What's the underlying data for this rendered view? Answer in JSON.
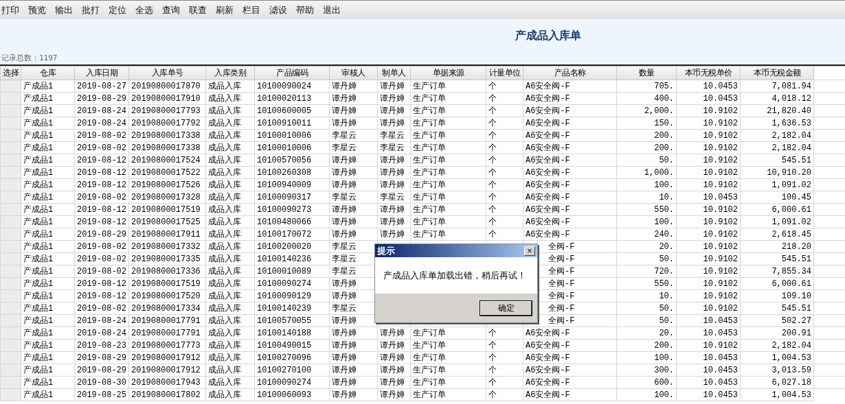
{
  "menu": [
    "打印",
    "预览",
    "输出",
    "批打",
    "定位",
    "全选",
    "查询",
    "联查",
    "刷新",
    "栏目",
    "滤设",
    "帮助",
    "退出"
  ],
  "title": "产成品入库单",
  "record_count": "记录总数：1197",
  "table": {
    "columns": [
      {
        "label": "选择",
        "kind": "selector"
      },
      {
        "label": "仓库",
        "kind": "text"
      },
      {
        "label": "入库日期",
        "kind": "text"
      },
      {
        "label": "入库单号",
        "kind": "text"
      },
      {
        "label": "入库类别",
        "kind": "text"
      },
      {
        "label": "产品编码",
        "kind": "text"
      },
      {
        "label": "审核人",
        "kind": "text"
      },
      {
        "label": "制单人",
        "kind": "text"
      },
      {
        "label": "单据来源",
        "kind": "text"
      },
      {
        "label": "计量单位",
        "kind": "text"
      },
      {
        "label": "产品名称",
        "kind": "text"
      },
      {
        "label": "数量",
        "kind": "number"
      },
      {
        "label": "本币无税单价",
        "kind": "number"
      },
      {
        "label": "本币无税金额",
        "kind": "number"
      }
    ],
    "rows": [
      {
        "covered": false,
        "cells": [
          "",
          "产成品1",
          "2019-08-27",
          "20190800017870",
          "成品入库",
          "10100090024",
          "谭丹婵",
          "谭丹婵",
          "生产订单",
          "个",
          "A6安全阀-F",
          "705.",
          "10.0453",
          "7,081.94"
        ]
      },
      {
        "covered": false,
        "cells": [
          "",
          "产成品1",
          "2019-08-29",
          "20190800017910",
          "成品入库",
          "10100020113",
          "谭丹婵",
          "谭丹婵",
          "生产订单",
          "个",
          "A6安全阀-F",
          "400.",
          "10.0453",
          "4,018.12"
        ]
      },
      {
        "covered": false,
        "cells": [
          "",
          "产成品1",
          "2019-08-24",
          "20190800017793",
          "成品入库",
          "10100600005",
          "谭丹婵",
          "谭丹婵",
          "生产订单",
          "个",
          "A6安全阀-F",
          "2,000.",
          "10.9102",
          "21,820.40"
        ]
      },
      {
        "covered": false,
        "cells": [
          "",
          "产成品1",
          "2019-08-24",
          "20190800017792",
          "成品入库",
          "10100910011",
          "谭丹婵",
          "谭丹婵",
          "生产订单",
          "个",
          "A6安全阀-F",
          "150.",
          "10.9102",
          "1,636.53"
        ]
      },
      {
        "covered": false,
        "cells": [
          "",
          "产成品1",
          "2019-08-02",
          "20190800017338",
          "成品入库",
          "10100010006",
          "李星云",
          "李星云",
          "生产订单",
          "个",
          "A6安全阀-F",
          "200.",
          "10.9102",
          "2,182.04"
        ]
      },
      {
        "covered": false,
        "cells": [
          "",
          "产成品1",
          "2019-08-02",
          "20190800017338",
          "成品入库",
          "10100010006",
          "李星云",
          "李星云",
          "生产订单",
          "个",
          "A6安全阀-F",
          "200.",
          "10.9102",
          "2,182.04"
        ]
      },
      {
        "covered": false,
        "cells": [
          "",
          "产成品1",
          "2019-08-12",
          "20190800017524",
          "成品入库",
          "10100570056",
          "谭丹婵",
          "谭丹婵",
          "生产订单",
          "个",
          "A6安全阀-F",
          "50.",
          "10.9102",
          "545.51"
        ]
      },
      {
        "covered": false,
        "cells": [
          "",
          "产成品1",
          "2019-08-12",
          "20190800017522",
          "成品入库",
          "10100260308",
          "谭丹婵",
          "谭丹婵",
          "生产订单",
          "个",
          "A6安全阀-F",
          "1,000.",
          "10.9102",
          "10,910.20"
        ]
      },
      {
        "covered": false,
        "cells": [
          "",
          "产成品1",
          "2019-08-12",
          "20190800017526",
          "成品入库",
          "10100940009",
          "谭丹婵",
          "谭丹婵",
          "生产订单",
          "个",
          "A6安全阀-F",
          "100.",
          "10.9102",
          "1,091.02"
        ]
      },
      {
        "covered": false,
        "cells": [
          "",
          "产成品1",
          "2019-08-02",
          "20190800017328",
          "成品入库",
          "10100090317",
          "李星云",
          "李星云",
          "生产订单",
          "个",
          "A6安全阀-F",
          "10.",
          "10.0453",
          "100.45"
        ]
      },
      {
        "covered": false,
        "cells": [
          "",
          "产成品1",
          "2019-08-12",
          "20190800017519",
          "成品入库",
          "10100090273",
          "谭丹婵",
          "谭丹婵",
          "生产订单",
          "个",
          "A6安全阀-F",
          "550.",
          "10.9102",
          "6,000.61"
        ]
      },
      {
        "covered": false,
        "cells": [
          "",
          "产成品1",
          "2019-08-12",
          "20190800017525",
          "成品入库",
          "10100480066",
          "谭丹婵",
          "谭丹婵",
          "生产订单",
          "个",
          "A6安全阀-F",
          "100.",
          "10.9102",
          "1,091.02"
        ]
      },
      {
        "covered": false,
        "cells": [
          "",
          "产成品1",
          "2019-08-29",
          "20190800017911",
          "成品入库",
          "10100170072",
          "谭丹婵",
          "谭丹婵",
          "生产订单",
          "个",
          "A6安全阀-F",
          "240.",
          "10.9102",
          "2,618.45"
        ]
      },
      {
        "covered": true,
        "cells": [
          "",
          "产成品1",
          "2019-08-02",
          "20190800017332",
          "成品入库",
          "10100200020",
          "李星云",
          null,
          null,
          null,
          "全阀-F",
          "20.",
          "10.9102",
          "218.20"
        ]
      },
      {
        "covered": true,
        "cells": [
          "",
          "产成品1",
          "2019-08-02",
          "20190800017335",
          "成品入库",
          "10100140236",
          "李星云",
          null,
          null,
          null,
          "全阀-F",
          "50.",
          "10.9102",
          "545.51"
        ]
      },
      {
        "covered": true,
        "cells": [
          "",
          "产成品1",
          "2019-08-02",
          "20190800017336",
          "成品入库",
          "10100010089",
          "李星云",
          null,
          null,
          null,
          "全阀-F",
          "720.",
          "10.9102",
          "7,855.34"
        ]
      },
      {
        "covered": true,
        "cells": [
          "",
          "产成品1",
          "2019-08-12",
          "20190800017519",
          "成品入库",
          "10100090274",
          "谭丹婵",
          null,
          null,
          null,
          "全阀-F",
          "550.",
          "10.9102",
          "6,000.61"
        ]
      },
      {
        "covered": true,
        "cells": [
          "",
          "产成品1",
          "2019-08-12",
          "20190800017520",
          "成品入库",
          "10100090129",
          "谭丹婵",
          null,
          null,
          null,
          "全阀-F",
          "10.",
          "10.9102",
          "109.10"
        ]
      },
      {
        "covered": true,
        "cells": [
          "",
          "产成品1",
          "2019-08-02",
          "20190800017334",
          "成品入库",
          "10100140239",
          "李星云",
          null,
          null,
          null,
          "全阀-F",
          "50.",
          "10.9102",
          "545.51"
        ]
      },
      {
        "covered": true,
        "cells": [
          "",
          "产成品1",
          "2019-08-24",
          "20190800017791",
          "成品入库",
          "10100570055",
          "谭丹婵",
          null,
          null,
          null,
          "全阀-F",
          "50.",
          "10.0453",
          "502.27"
        ]
      },
      {
        "covered": false,
        "cells": [
          "",
          "产成品1",
          "2019-08-24",
          "20190800017791",
          "成品入库",
          "10100140188",
          "谭丹婵",
          "谭丹婵",
          "生产订单",
          "个",
          "A6安全阀-F",
          "20.",
          "10.0453",
          "200.91"
        ]
      },
      {
        "covered": false,
        "cells": [
          "",
          "产成品1",
          "2019-08-23",
          "20190800017773",
          "成品入库",
          "10100490015",
          "谭丹婵",
          "谭丹婵",
          "生产订单",
          "个",
          "A6安全阀-F",
          "200.",
          "10.9102",
          "2,182.04"
        ]
      },
      {
        "covered": false,
        "cells": [
          "",
          "产成品1",
          "2019-08-29",
          "20190800017912",
          "成品入库",
          "10100270096",
          "谭丹婵",
          "谭丹婵",
          "生产订单",
          "个",
          "A6安全阀-F",
          "100.",
          "10.0453",
          "1,004.53"
        ]
      },
      {
        "covered": false,
        "cells": [
          "",
          "产成品1",
          "2019-08-29",
          "20190800017912",
          "成品入库",
          "10100270100",
          "谭丹婵",
          "谭丹婵",
          "生产订单",
          "个",
          "A6安全阀-F",
          "300.",
          "10.0453",
          "3,013.59"
        ]
      },
      {
        "covered": false,
        "cells": [
          "",
          "产成品1",
          "2019-08-30",
          "20190800017943",
          "成品入库",
          "10100090274",
          "谭丹婵",
          "谭丹婵",
          "生产订单",
          "个",
          "A6安全阀-F",
          "600.",
          "10.0453",
          "6,027.18"
        ]
      },
      {
        "covered": false,
        "cells": [
          "",
          "产成品1",
          "2019-08-25",
          "20190800017802",
          "成品入库",
          "10100060093",
          "谭丹婵",
          "谭丹婵",
          "生产订单",
          "个",
          "A6安全阀-F",
          "100.",
          "10.0453",
          "1,004.53"
        ]
      }
    ]
  },
  "dialog": {
    "title": "提示",
    "close": "×",
    "message": "产成品入库单加载出错，稍后再试！",
    "button": "确定"
  }
}
